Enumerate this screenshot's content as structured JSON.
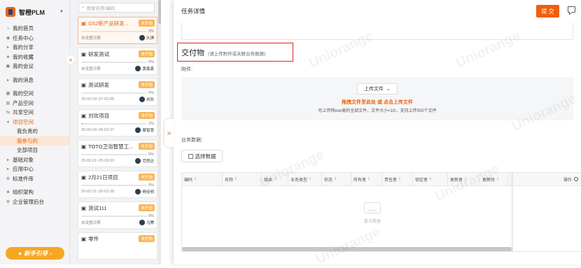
{
  "brand": {
    "name": "智橙PLM"
  },
  "nav": {
    "items": [
      {
        "label": "我的首页",
        "icon": "home-icon"
      },
      {
        "label": "任务中心",
        "icon": "task-icon"
      },
      {
        "label": "我的分享",
        "icon": "share-icon"
      },
      {
        "label": "我的收藏",
        "icon": "star-icon"
      },
      {
        "label": "我的会议",
        "icon": "meeting-icon"
      },
      {
        "label": "我的消息",
        "icon": "message-icon"
      },
      {
        "label": "我的空间",
        "icon": "space-icon"
      },
      {
        "label": "产品空间",
        "icon": "product-icon"
      },
      {
        "label": "共享空间",
        "icon": "share-space-icon"
      },
      {
        "label": "项目空间",
        "icon": "project-icon"
      },
      {
        "label": "我负责的"
      },
      {
        "label": "我参与的"
      },
      {
        "label": "全部项目"
      },
      {
        "label": "基础对象",
        "icon": "object-icon"
      },
      {
        "label": "应用中心",
        "icon": "app-icon"
      },
      {
        "label": "标准件库",
        "icon": "library-icon"
      },
      {
        "label": "组织架构",
        "icon": "org-icon"
      },
      {
        "label": "企业管理后台",
        "icon": "admin-icon"
      }
    ],
    "guide_label": "新手引导"
  },
  "search": {
    "placeholder": "搜索名称/编码"
  },
  "cards": [
    {
      "title": "G52新产品研发...",
      "tag": "未开始",
      "percent": "0%",
      "progress": 0,
      "date": "未设置日期",
      "owner": "久琪"
    },
    {
      "title": "研发测试",
      "tag": "未开始",
      "percent": "0%",
      "progress": 0,
      "date": "未设置日期",
      "owner": "黄鑫鑫"
    },
    {
      "title": "测试研发",
      "tag": "未开始",
      "percent": "0%",
      "progress": 0,
      "date": "25-02-24~27-02-05",
      "owner": "刘欢"
    },
    {
      "title": "刘欢项目",
      "tag": "未开始",
      "percent": "2%",
      "progress": 0.02,
      "date": "25-02-24~26-02-27",
      "owner": "蔡智慧"
    },
    {
      "title": "TOTO卫浴智慧工...",
      "tag": "未开始",
      "percent": "0%",
      "progress": 0,
      "date": "25-02-21~25-03-10",
      "owner": "范思达"
    },
    {
      "title": "2月21日项目",
      "tag": "未开始",
      "percent": "0%",
      "progress": 0,
      "date": "25-02-21~25-02-28",
      "owner": "杨佳明"
    },
    {
      "title": "测试111",
      "tag": "未开始",
      "percent": "0%",
      "progress": 0,
      "date": "未设置日期",
      "owner": "马腾"
    },
    {
      "title": "零件",
      "tag": "未开始"
    }
  ],
  "drawer": {
    "title": "任务详情",
    "submit_label": "提 交",
    "deliverable_title": "交付物",
    "deliverable_hint": "(请上传附件或关联业务数据)",
    "attachment_label": "附件:",
    "upload_button": "上传文件",
    "upload_drag": "拖拽文件至此处 或 点击上传文件",
    "upload_limit": "可上传除exe类的全部文件，文件大小<1G，支持上传500个文件",
    "business_label": "业务数据:",
    "choose_data": "选择数据",
    "columns": [
      "编码",
      "名称",
      "版本",
      "业务类型",
      "状态",
      "所有者",
      "责任者",
      "锁定者",
      "更新者",
      "更新时"
    ],
    "op_label": "操作",
    "empty_text": "暂无数据"
  },
  "watermark": "Uniorange"
}
